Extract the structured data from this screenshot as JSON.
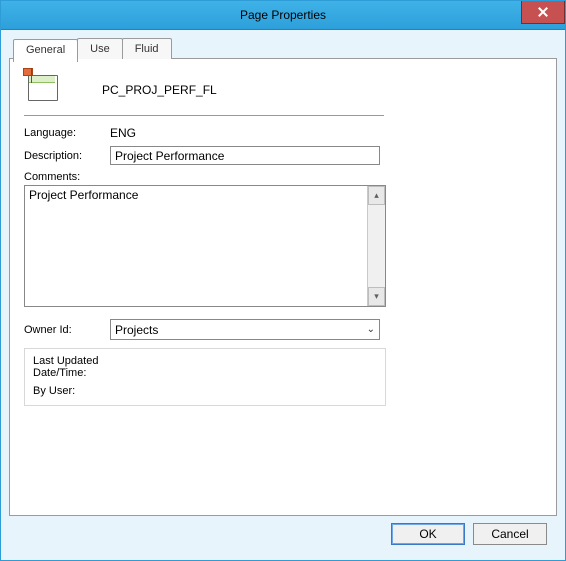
{
  "window": {
    "title": "Page Properties"
  },
  "tabs": [
    {
      "label": "General"
    },
    {
      "label": "Use"
    },
    {
      "label": "Fluid"
    }
  ],
  "general": {
    "page_name": "PC_PROJ_PERF_FL",
    "labels": {
      "language": "Language:",
      "description": "Description:",
      "comments": "Comments:",
      "owner_id": "Owner Id:",
      "last_updated": "Last Updated\nDate/Time:",
      "by_user": "By User:"
    },
    "values": {
      "language": "ENG",
      "description": "Project Performance",
      "comments": "Project Performance",
      "owner_id_selected": "Projects",
      "last_updated": "",
      "by_user": ""
    }
  },
  "buttons": {
    "ok": "OK",
    "cancel": "Cancel"
  }
}
